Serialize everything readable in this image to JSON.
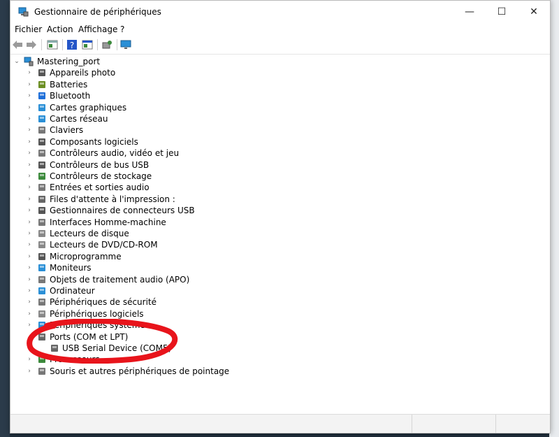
{
  "window": {
    "title": "Gestionnaire de périphériques",
    "minimize": "—",
    "maximize": "☐",
    "close": "✕"
  },
  "menu": [
    "Fichier",
    "Action",
    "Affichage",
    "?"
  ],
  "tree": {
    "root": "Mastering_port",
    "items": [
      {
        "label": "Appareils photo",
        "icon": "camera-icon",
        "color": "#555555"
      },
      {
        "label": "Batteries",
        "icon": "battery-icon",
        "color": "#6b8e23"
      },
      {
        "label": "Bluetooth",
        "icon": "bluetooth-icon",
        "color": "#1e6fd9"
      },
      {
        "label": "Cartes graphiques",
        "icon": "display-adapter-icon",
        "color": "#2a8fd6"
      },
      {
        "label": "Cartes réseau",
        "icon": "network-adapter-icon",
        "color": "#2a8fd6"
      },
      {
        "label": "Claviers",
        "icon": "keyboard-icon",
        "color": "#777777"
      },
      {
        "label": "Composants logiciels",
        "icon": "software-component-icon",
        "color": "#555555"
      },
      {
        "label": "Contrôleurs audio, vidéo et jeu",
        "icon": "speaker-icon",
        "color": "#777777"
      },
      {
        "label": "Contrôleurs de bus USB",
        "icon": "usb-icon",
        "color": "#555555"
      },
      {
        "label": "Contrôleurs de stockage",
        "icon": "storage-controller-icon",
        "color": "#3c8a3c"
      },
      {
        "label": "Entrées et sorties audio",
        "icon": "audio-io-icon",
        "color": "#777777"
      },
      {
        "label": "Files d'attente à l'impression :",
        "icon": "printer-icon",
        "color": "#666666"
      },
      {
        "label": "Gestionnaires de connecteurs USB",
        "icon": "usb-connector-icon",
        "color": "#555555"
      },
      {
        "label": "Interfaces Homme-machine",
        "icon": "hid-icon",
        "color": "#777777"
      },
      {
        "label": "Lecteurs de disque",
        "icon": "disk-drive-icon",
        "color": "#888888"
      },
      {
        "label": "Lecteurs de DVD/CD-ROM",
        "icon": "dvd-drive-icon",
        "color": "#888888"
      },
      {
        "label": "Microprogramme",
        "icon": "firmware-icon",
        "color": "#555555"
      },
      {
        "label": "Moniteurs",
        "icon": "monitor-icon",
        "color": "#2a8fd6"
      },
      {
        "label": "Objets de traitement audio (APO)",
        "icon": "apo-icon",
        "color": "#777777"
      },
      {
        "label": "Ordinateur",
        "icon": "computer-icon",
        "color": "#2a8fd6"
      },
      {
        "label": "Périphériques de sécurité",
        "icon": "security-device-icon",
        "color": "#777777"
      },
      {
        "label": "Périphériques logiciels",
        "icon": "software-device-icon",
        "color": "#888888"
      },
      {
        "label": "Périphériques système",
        "icon": "system-device-icon",
        "color": "#2a8fd6"
      },
      {
        "label": "Ports (COM et LPT)",
        "icon": "port-icon",
        "color": "#666666"
      },
      {
        "label": "USB Serial Device (COM5)",
        "icon": "port-icon",
        "color": "#666666"
      },
      {
        "label": "Processeurs",
        "icon": "processor-icon",
        "color": "#3c8a3c"
      },
      {
        "label": "Souris et autres périphériques de pointage",
        "icon": "mouse-icon",
        "color": "#777777"
      }
    ]
  },
  "annotation_color": "#e8141b"
}
